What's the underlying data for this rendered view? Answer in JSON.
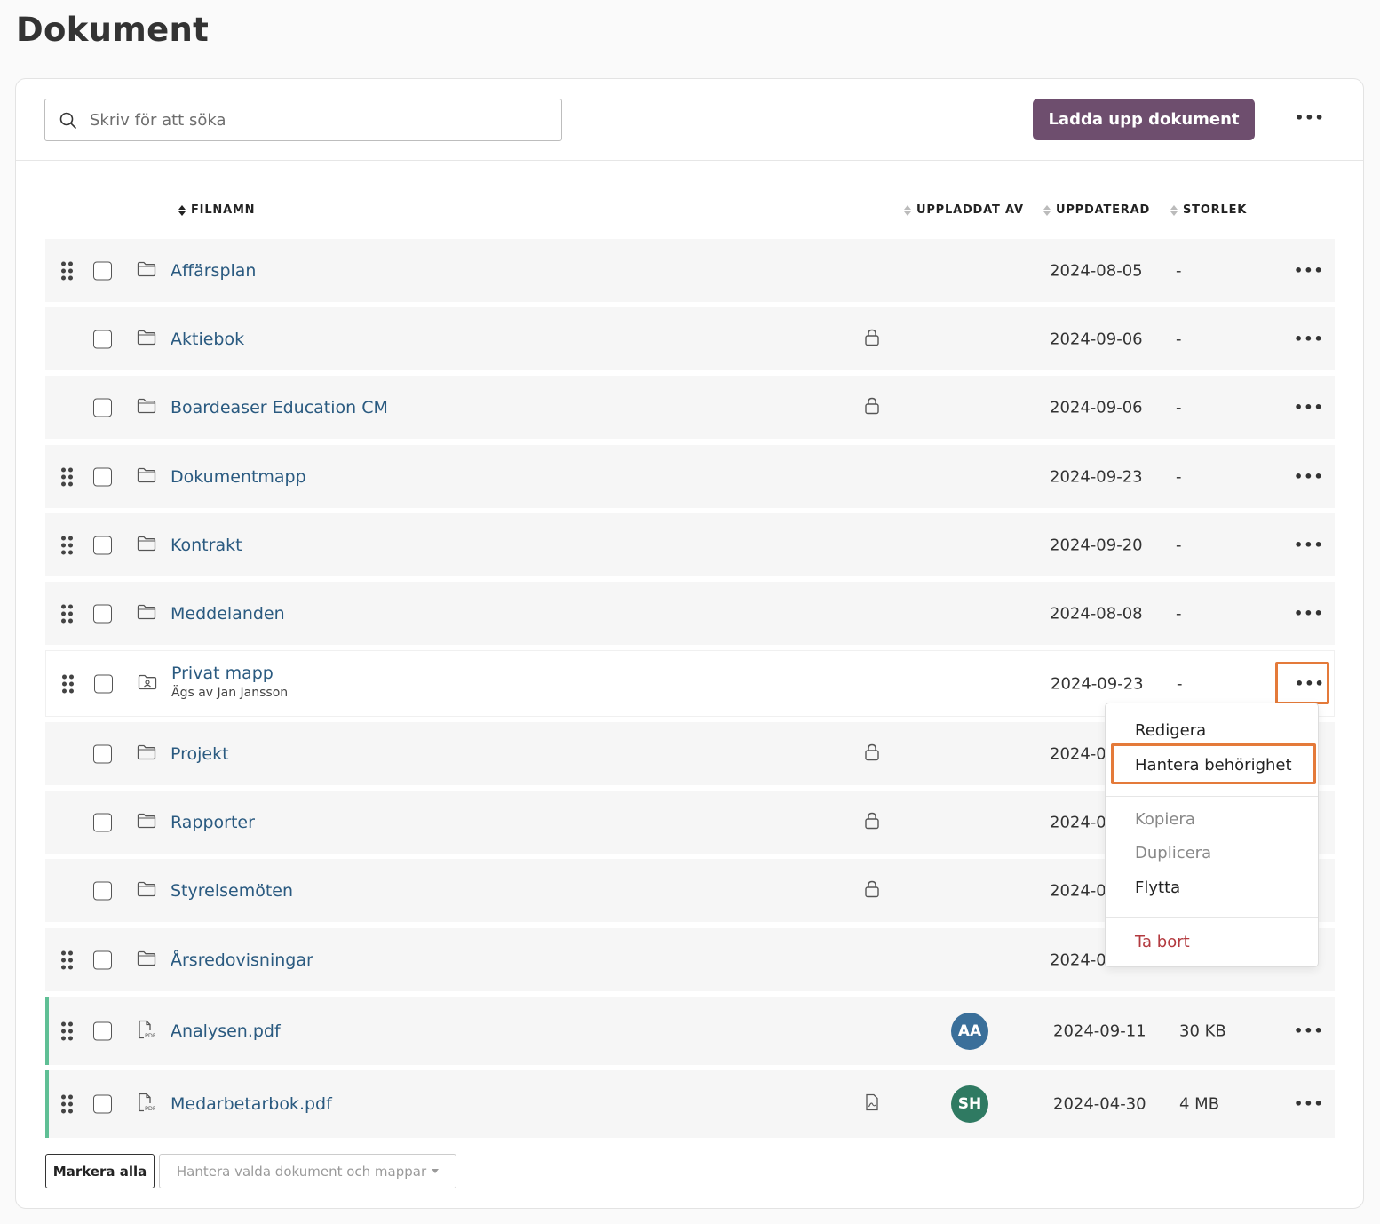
{
  "page": {
    "title": "Dokument"
  },
  "toolbar": {
    "search_placeholder": "Skriv för att söka",
    "upload_label": "Ladda upp dokument",
    "more_icon": "ellipsis-icon"
  },
  "columns": {
    "filename": "FILNAMN",
    "uploaded_by": "UPPLADDAT AV",
    "updated": "UPPDATERAD",
    "size": "STORLEK",
    "sorted_by": "filename"
  },
  "rows": [
    {
      "name": "Affärsplan",
      "type": "folder",
      "draggable": true,
      "locked": false,
      "date": "2024-08-05",
      "size": "-"
    },
    {
      "name": "Aktiebok",
      "type": "folder",
      "draggable": false,
      "locked": true,
      "date": "2024-09-06",
      "size": "-"
    },
    {
      "name": "Boardeaser Education CM",
      "type": "folder",
      "draggable": false,
      "locked": true,
      "date": "2024-09-06",
      "size": "-"
    },
    {
      "name": "Dokumentmapp",
      "type": "folder",
      "draggable": true,
      "locked": false,
      "date": "2024-09-23",
      "size": "-"
    },
    {
      "name": "Kontrakt",
      "type": "folder",
      "draggable": true,
      "locked": false,
      "date": "2024-09-20",
      "size": "-"
    },
    {
      "name": "Meddelanden",
      "type": "folder",
      "draggable": true,
      "locked": false,
      "date": "2024-08-08",
      "size": "-"
    },
    {
      "name": "Privat mapp",
      "owner": "Ägs av Jan Jansson",
      "type": "private-folder",
      "draggable": true,
      "locked": false,
      "date": "2024-09-23",
      "size": "-"
    },
    {
      "name": "Projekt",
      "type": "folder",
      "draggable": false,
      "locked": true,
      "date": "2024-0",
      "size": ""
    },
    {
      "name": "Rapporter",
      "type": "folder",
      "draggable": false,
      "locked": true,
      "date": "2024-0",
      "size": ""
    },
    {
      "name": "Styrelsemöten",
      "type": "folder",
      "draggable": false,
      "locked": true,
      "date": "2024-0",
      "size": ""
    },
    {
      "name": "Årsredovisningar",
      "type": "folder",
      "draggable": true,
      "locked": false,
      "date": "2024-0",
      "size": ""
    },
    {
      "name": "Analysen.pdf",
      "type": "pdf",
      "draggable": true,
      "locked": false,
      "avatar": "AA",
      "avatar_color": "#3a6f9a",
      "date": "2024-09-11",
      "size": "30 KB"
    },
    {
      "name": "Medarbetarbok.pdf",
      "type": "pdf",
      "draggable": true,
      "locked": false,
      "has_preview": true,
      "avatar": "SH",
      "avatar_color": "#2f7a62",
      "date": "2024-04-30",
      "size": "4 MB"
    }
  ],
  "context_menu": {
    "items": [
      {
        "label": "Redigera",
        "state": "normal"
      },
      {
        "label": "Hantera behörighet",
        "state": "normal",
        "focused": true
      },
      {
        "label": "Kopiera",
        "state": "disabled"
      },
      {
        "label": "Duplicera",
        "state": "disabled"
      },
      {
        "label": "Flytta",
        "state": "normal"
      },
      {
        "label": "Ta bort",
        "state": "danger"
      }
    ]
  },
  "footer": {
    "select_all_label": "Markera alla",
    "bulk_label": "Hantera valda dokument och mappar"
  },
  "colors": {
    "primary": "#6e4e6e",
    "link": "#2a5a80",
    "focus_outline": "#e47a3a",
    "file_accent": "#5fbf95",
    "danger": "#b33a3f"
  }
}
